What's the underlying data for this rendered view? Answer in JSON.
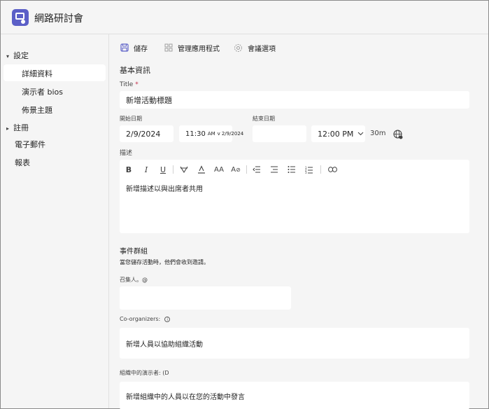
{
  "app": {
    "title": "網路研討會"
  },
  "sidebar": {
    "groups": [
      {
        "label": "設定",
        "expanded": true
      },
      {
        "label": "註冊",
        "expanded": false
      }
    ],
    "items": {
      "details": "詳細資料",
      "presenter_bios": "演示者 bios",
      "theme": "佈景主題",
      "email": "電子郵件",
      "reports": "報表"
    }
  },
  "toolbar": {
    "save": "儲存",
    "manage_apps": "管理應用程式",
    "meeting_options": "會議選項"
  },
  "form": {
    "basic_info": "基本資訊",
    "title_label": "Title",
    "title_required": "*",
    "title_placeholder": "新增活動標題",
    "start_date_label": "開始日期",
    "end_date_label": "結束日期",
    "start_date": "2/9/2024",
    "start_time": "11:30",
    "start_time_suffix": "AM",
    "start_time_suffix2": "2/9/2024",
    "end_time": "12:00 PM",
    "duration": "30m",
    "description_label": "描述",
    "description_placeholder": "新增描述以與出席者共用",
    "event_group_title": "事件群組",
    "event_group_hint": "當您儲存活動時，他們會收到邀請。",
    "organizer_label": "召集人。@",
    "coorganizers_label": "Co-organizers:",
    "coorganizers_placeholder": "新增人員以協助組織活動",
    "org_presenters_label": "組織中的演示者: (D",
    "org_presenters_placeholder": "新增組織中的人員以在您的活動中發言"
  },
  "colors": {
    "brand": "#5b5fc7",
    "required": "#c4314b"
  }
}
